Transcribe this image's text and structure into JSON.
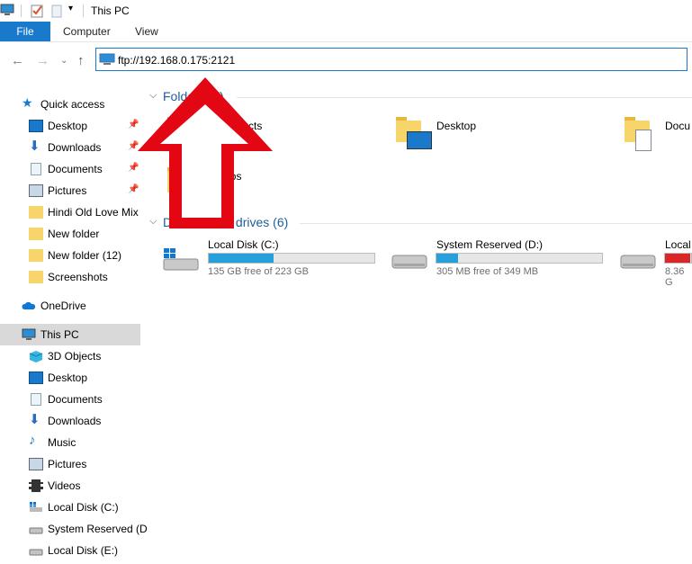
{
  "window": {
    "title": "This PC"
  },
  "ribbon": {
    "tabs": [
      "File",
      "Computer",
      "View"
    ]
  },
  "address": {
    "value": "ftp://192.168.0.175:2121"
  },
  "sidebar": {
    "quick_access": "Quick access",
    "quick_items": [
      "Desktop",
      "Downloads",
      "Documents",
      "Pictures",
      "Hindi Old Love Mix",
      "New folder",
      "New folder (12)",
      "Screenshots"
    ],
    "onedrive": "OneDrive",
    "this_pc": "This PC",
    "pc_items": [
      "3D Objects",
      "Desktop",
      "Documents",
      "Downloads",
      "Music",
      "Pictures",
      "Videos",
      "Local Disk (C:)",
      "System Reserved (D",
      "Local Disk (E:)"
    ]
  },
  "folders": {
    "header": "Folders (7)",
    "items": [
      "3D Objects",
      "Desktop",
      "Docu",
      "Videos"
    ]
  },
  "drives": {
    "header": "Devices and drives (6)",
    "items": [
      {
        "name": "Local Disk (C:)",
        "free": "135 GB free of 223 GB",
        "used_fraction": 0.39,
        "color": "#26a0da"
      },
      {
        "name": "System Reserved (D:)",
        "free": "305 MB free of 349 MB",
        "used_fraction": 0.13,
        "color": "#26a0da"
      },
      {
        "name": "Local",
        "free": "8.36 G",
        "used_fraction": 0.95,
        "color": "#da2626"
      }
    ]
  },
  "colors": {
    "accent": "#1979ca",
    "arrow": "#e30613"
  }
}
